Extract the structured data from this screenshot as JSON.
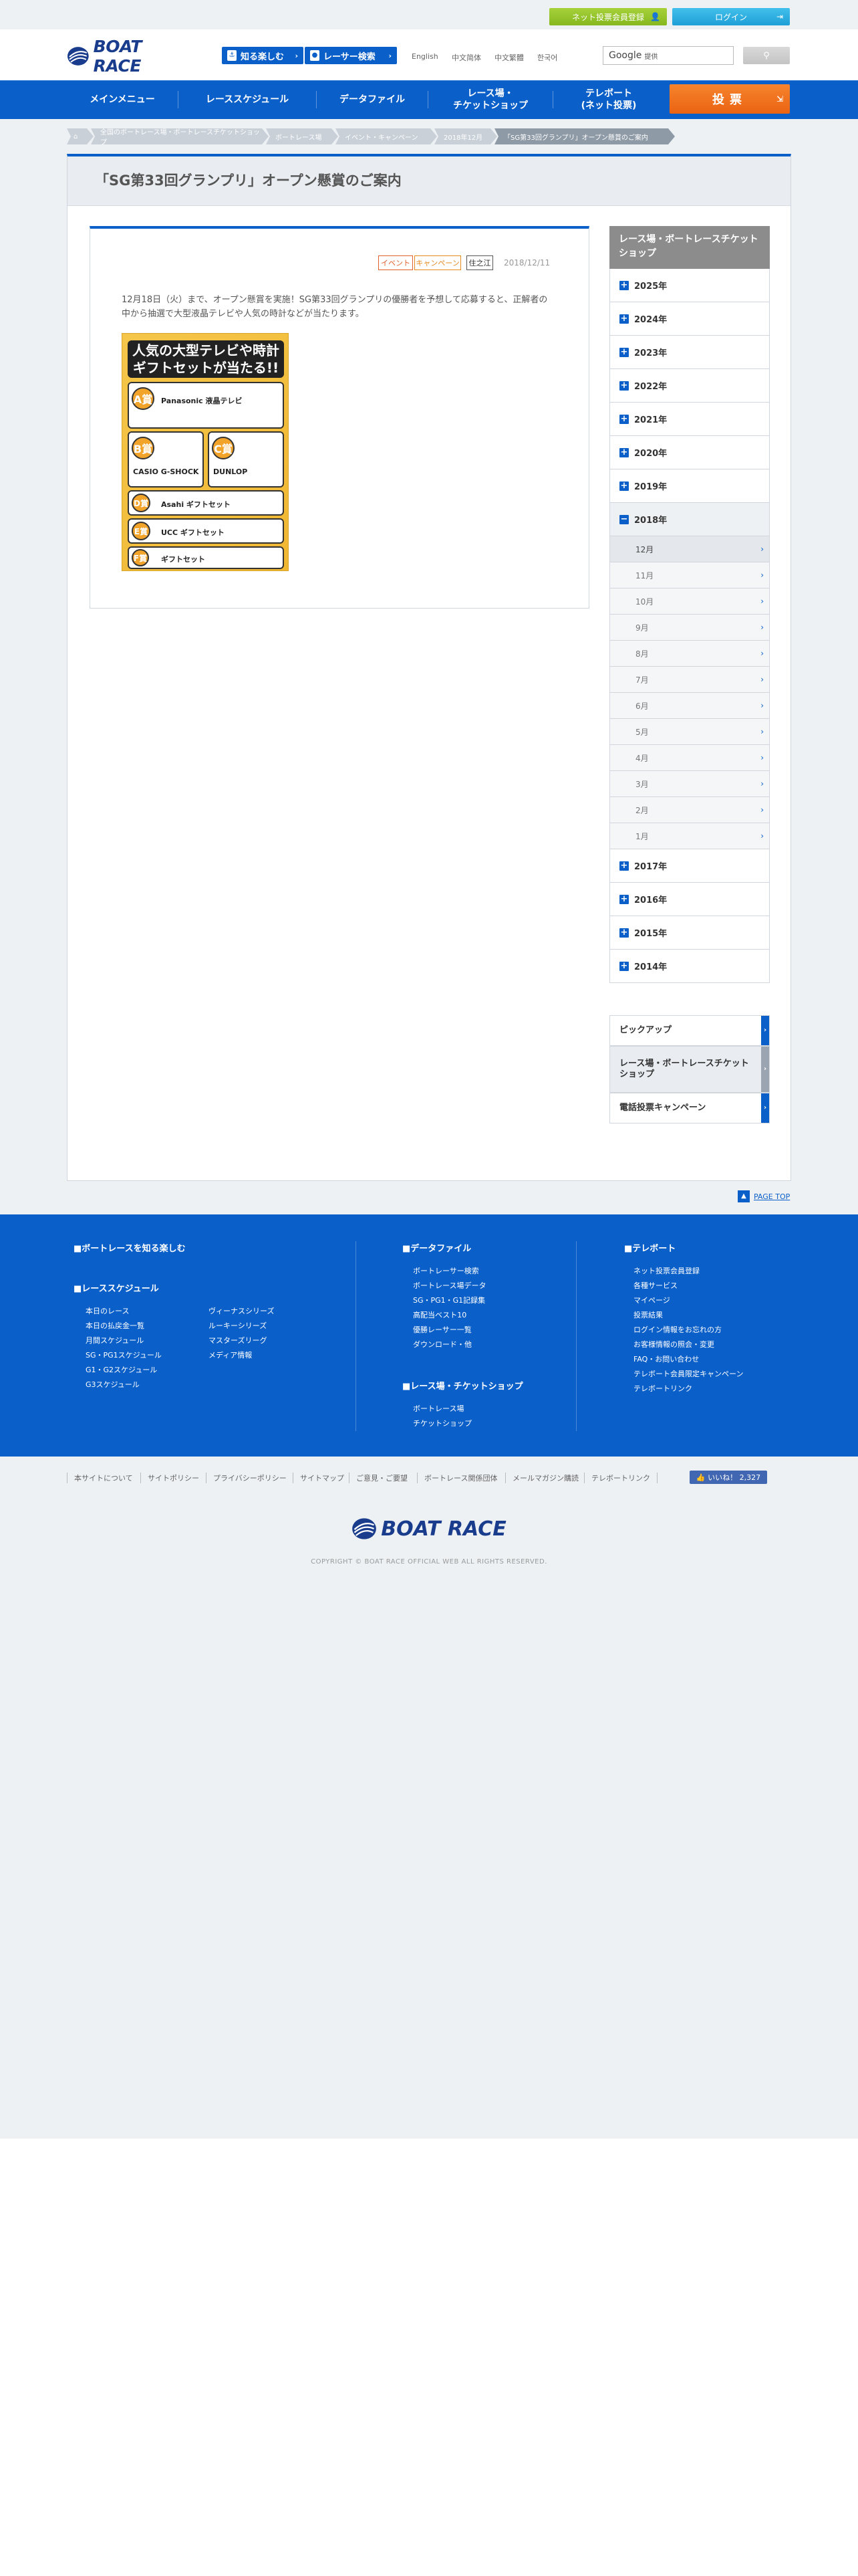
{
  "topbar": {
    "register_label": "ネット投票会員登録",
    "login_label": "ログイン"
  },
  "header": {
    "logo_text": "BOAT RACE",
    "know_label": "知る楽しむ",
    "racer_label": "レーサー検索",
    "languages": [
      "English",
      "中文简体",
      "中文繁體",
      "한국어"
    ],
    "search_brand": "Google",
    "search_placeholder": "提供"
  },
  "nav": {
    "items": [
      "メインメニュー",
      "レーススケジュール",
      "データファイル",
      "レース場・\nチケットショップ",
      "テレボート\n(ネット投票)"
    ],
    "vote_label": "投票"
  },
  "breadcrumb": [
    "全国のボートレース場・ボートレースチケットショップ",
    "ボートレース場",
    "イベント・キャンペーン",
    "2018年12月",
    "「SG第33回グランプリ」オープン懸賞のご案内"
  ],
  "main": {
    "title": "「SG第33回グランプリ」オープン懸賞のご案内",
    "tags": [
      "イベント",
      "キャンペーン",
      "住之江"
    ],
    "date": "2018/12/11",
    "body": "12月18日（火）まで、オープン懸賞を実施！SG第33回グランプリの優勝者を予想して応募すると、正解者の中から抽選で大型液晶テレビや人気の時計などが当たります。",
    "poster": {
      "headline": "人気の大型テレビや時計\nギフトセットが当たる!!",
      "prizes": [
        {
          "rank": "A賞",
          "name": "Panasonic 液晶テレビ"
        },
        {
          "rank": "B賞",
          "name": "CASIO G-SHOCK"
        },
        {
          "rank": "C賞",
          "name": "DUNLOP"
        },
        {
          "rank": "D賞",
          "name": "Asahi ギフトセット"
        },
        {
          "rank": "E賞",
          "name": "UCC ギフトセット"
        },
        {
          "rank": "F賞",
          "name": "ギフトセット"
        }
      ]
    }
  },
  "sidebar": {
    "title": "レース場・ボートレースチケットショップ",
    "years_before": [
      "2025年",
      "2024年",
      "2023年",
      "2022年",
      "2021年",
      "2020年",
      "2019年"
    ],
    "open_year": "2018年",
    "months": [
      "12月",
      "11月",
      "10月",
      "9月",
      "8月",
      "7月",
      "6月",
      "5月",
      "4月",
      "3月",
      "2月",
      "1月"
    ],
    "years_after": [
      "2017年",
      "2016年",
      "2015年",
      "2014年"
    ],
    "pickup": [
      "ピックアップ",
      "レース場・ボートレースチケットショップ",
      "電話投票キャンペーン"
    ]
  },
  "pagetop_label": "PAGE TOP",
  "footer": {
    "col1_head": "ボートレースを知る楽しむ",
    "schedule_head": "レーススケジュール",
    "schedule_left": [
      "本日のレース",
      "本日の払戻金一覧",
      "月間スケジュール",
      "SG・PG1スケジュール",
      "G1・G2スケジュール",
      "G3スケジュール"
    ],
    "schedule_right": [
      "ヴィーナスシリーズ",
      "ルーキーシリーズ",
      "マスターズリーグ",
      "メディア情報"
    ],
    "data_head": "データファイル",
    "data_links": [
      "ボートレーサー検索",
      "ボートレース場データ",
      "SG・PG1・G1記録集",
      "高配当ベスト10",
      "優勝レーサー一覧",
      "ダウンロード・他"
    ],
    "ticket_head": "レース場・チケットショップ",
    "ticket_links": [
      "ボートレース場",
      "チケットショップ"
    ],
    "tele_head": "テレボート",
    "tele_links": [
      "ネット投票会員登録",
      "各種サービス",
      "マイページ",
      "投票結果",
      "ログイン情報をお忘れの方",
      "お客様情報の照会・変更",
      "FAQ・お問い合わせ",
      "テレボート会員限定キャンペーン",
      "テレボートリンク"
    ]
  },
  "bottom_links": [
    "本サイトについて",
    "サイトポリシー",
    "プライバシーポリシー",
    "サイトマップ",
    "ご意見・ご要望",
    "ボートレース関係団体",
    "メールマガジン購読",
    "テレボートリンク"
  ],
  "like_label": "いいね！ 2,327",
  "copyright": "COPYRIGHT © BOAT RACE OFFICIAL WEB ALL RIGHTS RESERVED."
}
